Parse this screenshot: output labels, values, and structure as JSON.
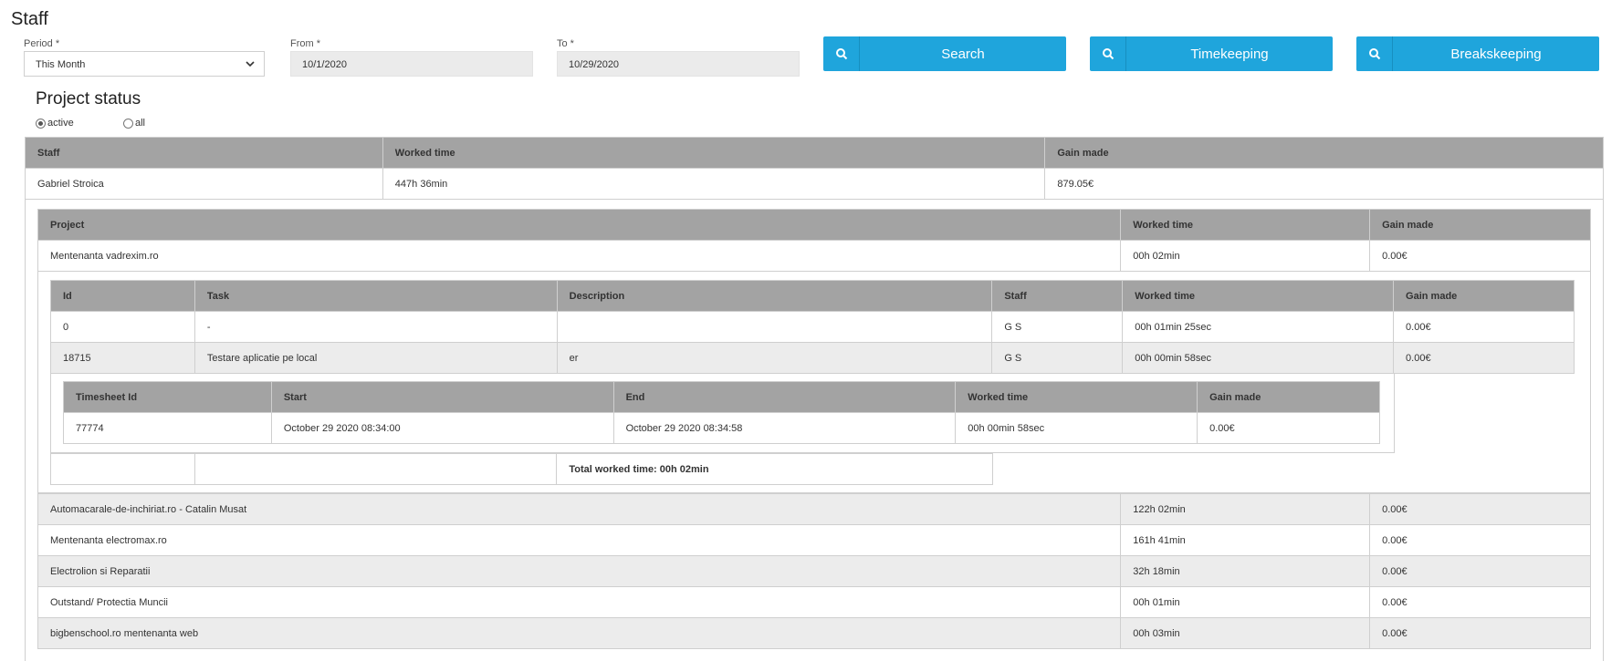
{
  "page_title": "Staff",
  "filters": {
    "period_label": "Period *",
    "period_value": "This Month",
    "from_label": "From *",
    "from_value": "10/1/2020",
    "to_label": "To *",
    "to_value": "10/29/2020"
  },
  "buttons": {
    "search": "Search",
    "timekeeping": "Timekeeping",
    "breakskeeping": "Breakskeeping",
    "icon": "search-icon"
  },
  "project_status": {
    "title": "Project status",
    "radio_active": "active",
    "radio_all": "all",
    "selected": "active"
  },
  "staff_table": {
    "headers": [
      "Staff",
      "Worked time",
      "Gain made"
    ],
    "row": [
      "Gabriel Stroica",
      "447h 36min",
      "879.05€"
    ]
  },
  "project_table": {
    "headers": [
      "Project",
      "Worked time",
      "Gain made"
    ],
    "first_row": [
      "Mentenanta vadrexim.ro",
      "00h 02min",
      "0.00€"
    ],
    "rows": [
      [
        "Automacarale-de-inchiriat.ro - Catalin Musat",
        "122h 02min",
        "0.00€"
      ],
      [
        "Mentenanta electromax.ro",
        "161h 41min",
        "0.00€"
      ],
      [
        "Electrolion si Reparatii",
        "32h 18min",
        "0.00€"
      ],
      [
        "Outstand/ Protectia Muncii",
        "00h 01min",
        "0.00€"
      ],
      [
        "bigbenschool.ro mentenanta web",
        "00h 03min",
        "0.00€"
      ]
    ]
  },
  "task_table": {
    "headers": [
      "Id",
      "Task",
      "Description",
      "Staff",
      "Worked time",
      "Gain made"
    ],
    "rows": [
      [
        "0",
        "-",
        "",
        "G S",
        "00h 01min 25sec",
        "0.00€"
      ],
      [
        "18715",
        "Testare aplicatie pe local",
        "er",
        "G S",
        "00h 00min 58sec",
        "0.00€"
      ]
    ],
    "total": "Total worked time: 00h 02min"
  },
  "timesheet_table": {
    "headers": [
      "Timesheet Id",
      "Start",
      "End",
      "Worked time",
      "Gain made"
    ],
    "row": [
      "77774",
      "October 29 2020 08:34:00",
      "October 29 2020 08:34:58",
      "00h 00min 58sec",
      "0.00€"
    ]
  }
}
